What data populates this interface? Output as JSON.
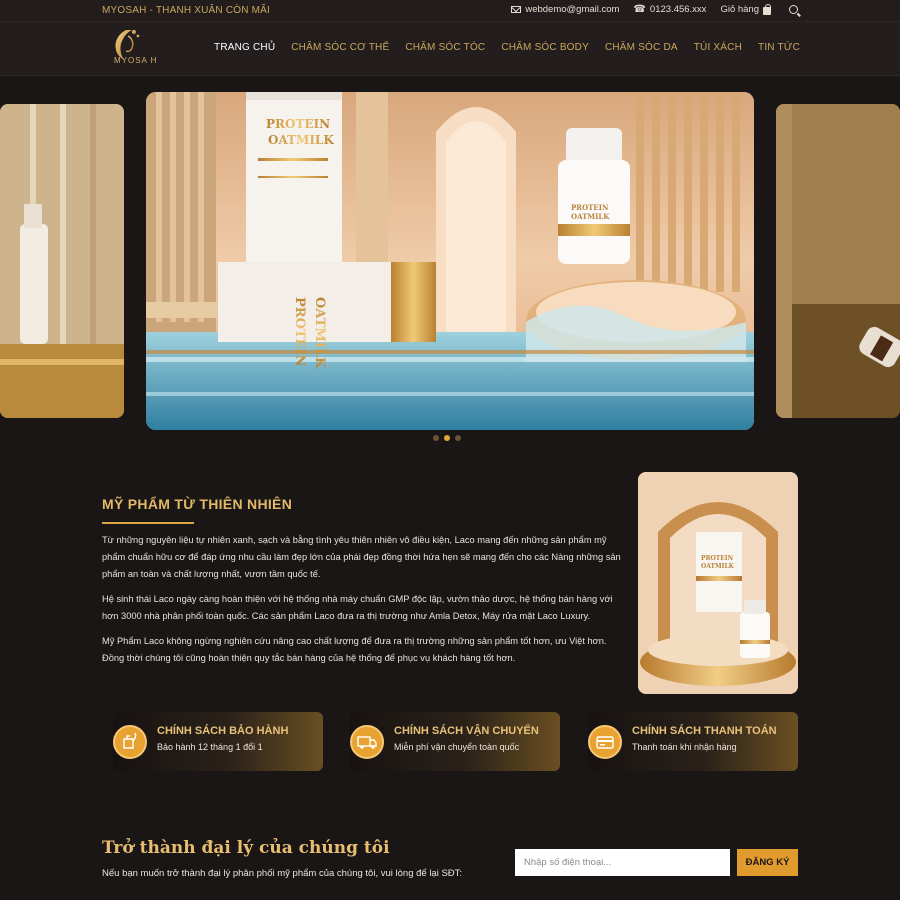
{
  "topbar": {
    "tagline": "MYOSAH - THANH XUÂN CÒN MÃI",
    "email": "webdemo@gmail.com",
    "phone": "0123.456.xxx",
    "cart_label": "Giỏ hàng"
  },
  "header": {
    "logo_text": "MYOSA H",
    "nav": [
      {
        "label": "TRANG CHỦ",
        "active": true
      },
      {
        "label": "CHĂM SÓC CƠ THỂ"
      },
      {
        "label": "CHĂM SÓC TÓC"
      },
      {
        "label": "CHĂM SÓC BODY"
      },
      {
        "label": "CHĂM SÓC DA"
      },
      {
        "label": "TÚI XÁCH"
      },
      {
        "label": "TIN TỨC"
      }
    ]
  },
  "slider": {
    "product_text": {
      "line1": "PROTEIN",
      "line2": "OATMILK"
    },
    "dots_count": 3,
    "active_dot": 1
  },
  "about": {
    "title": "MỸ PHẨM TỪ THIÊN NHIÊN",
    "paragraphs": [
      "Từ những nguyên liệu tự nhiên xanh, sạch và bằng tình yêu thiên nhiên vô điều kiện, Laco mang đến những sản phẩm mỹ phẩm chuẩn hữu cơ để đáp ứng nhu cầu làm đẹp lớn của phái đẹp đồng thời hứa hẹn sẽ mang đến cho các Nàng những sản phẩm an toàn và chất lượng nhất, vươn tầm quốc tế.",
      "Hệ sinh thái Laco ngày càng hoàn thiện với hệ thống nhà máy chuẩn GMP độc lập, vườn thảo dược, hệ thống bán hàng với hơn 3000 nhà phân phối toàn quốc. Các sản phẩm Laco đưa ra thị trường như Amla Detox, Máy rửa mặt Laco Luxury.",
      "Mỹ Phẩm Laco không ngừng nghiên cứu nâng cao chất lượng để đưa ra thị trường những sản phẩm tốt hơn, ưu Việt hơn. Đồng thời chúng tôi cũng hoàn thiện quy tắc bán hàng của hệ thống để phục vụ khách hàng tốt hơn."
    ]
  },
  "policies": [
    {
      "title": "CHÍNH SÁCH BẢO HÀNH",
      "desc": "Bảo hành 12 tháng 1 đổi 1",
      "icon": "warranty-icon"
    },
    {
      "title": "CHÍNH SÁCH VẬN CHUYỂN",
      "desc": "Miễn phí vận chuyển toàn quốc",
      "icon": "truck-icon"
    },
    {
      "title": "CHÍNH SÁCH THANH TOÁN",
      "desc": "Thanh toán khi nhận hàng",
      "icon": "card-icon"
    }
  ],
  "subscribe": {
    "title": "Trở thành đại lý của chúng tôi",
    "desc": "Nếu bạn muốn trở thành đại lý phân phối mỹ phẩm của chúng tôi, vui lòng để lại SĐT:",
    "placeholder": "Nhập số điện thoại...",
    "button": "ĐĂNG KÝ"
  },
  "colors": {
    "background": "#1b1616",
    "accent": "#e09a2d",
    "gold_text": "#e2b968"
  }
}
